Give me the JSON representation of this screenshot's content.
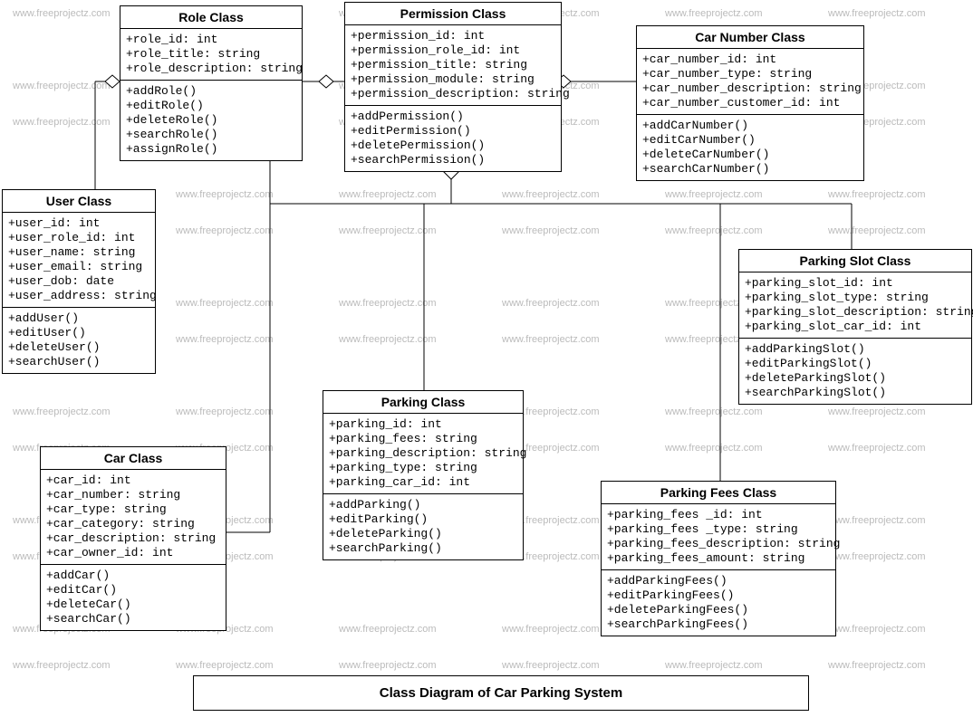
{
  "diagram_title": "Class Diagram of Car Parking System",
  "watermark_text": "www.freeprojectz.com",
  "classes": {
    "role": {
      "title": "Role Class",
      "attrs": [
        "+role_id: int",
        "+role_title: string",
        "+role_description: string"
      ],
      "ops": [
        "+addRole()",
        "+editRole()",
        "+deleteRole()",
        "+searchRole()",
        "+assignRole()"
      ]
    },
    "permission": {
      "title": "Permission Class",
      "attrs": [
        "+permission_id: int",
        "+permission_role_id: int",
        "+permission_title: string",
        "+permission_module: string",
        "+permission_description: string"
      ],
      "ops": [
        "+addPermission()",
        "+editPermission()",
        "+deletePermission()",
        "+searchPermission()"
      ]
    },
    "carnumber": {
      "title": "Car Number Class",
      "attrs": [
        "+car_number_id: int",
        "+car_number_type: string",
        "+car_number_description: string",
        "+car_number_customer_id: int"
      ],
      "ops": [
        "+addCarNumber()",
        "+editCarNumber()",
        "+deleteCarNumber()",
        "+searchCarNumber()"
      ]
    },
    "user": {
      "title": "User Class",
      "attrs": [
        "+user_id: int",
        "+user_role_id: int",
        "+user_name: string",
        "+user_email: string",
        "+user_dob: date",
        "+user_address: string"
      ],
      "ops": [
        "+addUser()",
        "+editUser()",
        "+deleteUser()",
        "+searchUser()"
      ]
    },
    "parkingslot": {
      "title": "Parking Slot Class",
      "attrs": [
        "+parking_slot_id: int",
        "+parking_slot_type: string",
        "+parking_slot_description: string",
        "+parking_slot_car_id: int"
      ],
      "ops": [
        "+addParkingSlot()",
        "+editParkingSlot()",
        "+deleteParkingSlot()",
        "+searchParkingSlot()"
      ]
    },
    "parking": {
      "title": "Parking Class",
      "attrs": [
        "+parking_id: int",
        "+parking_fees: string",
        "+parking_description: string",
        "+parking_type: string",
        "+parking_car_id: int"
      ],
      "ops": [
        "+addParking()",
        "+editParking()",
        "+deleteParking()",
        "+searchParking()"
      ]
    },
    "car": {
      "title": "Car Class",
      "attrs": [
        "+car_id: int",
        "+car_number: string",
        "+car_type: string",
        "+car_category: string",
        "+car_description: string",
        "+car_owner_id: int"
      ],
      "ops": [
        "+addCar()",
        "+editCar()",
        "+deleteCar()",
        "+searchCar()"
      ]
    },
    "parkingfees": {
      "title": "Parking Fees Class",
      "attrs": [
        "+parking_fees _id: int",
        "+parking_fees _type: string",
        "+parking_fees_description: string",
        "+parking_fees_amount: string"
      ],
      "ops": [
        "+addParkingFees()",
        "+editParkingFees()",
        "+deleteParkingFees()",
        "+searchParkingFees()"
      ]
    }
  }
}
